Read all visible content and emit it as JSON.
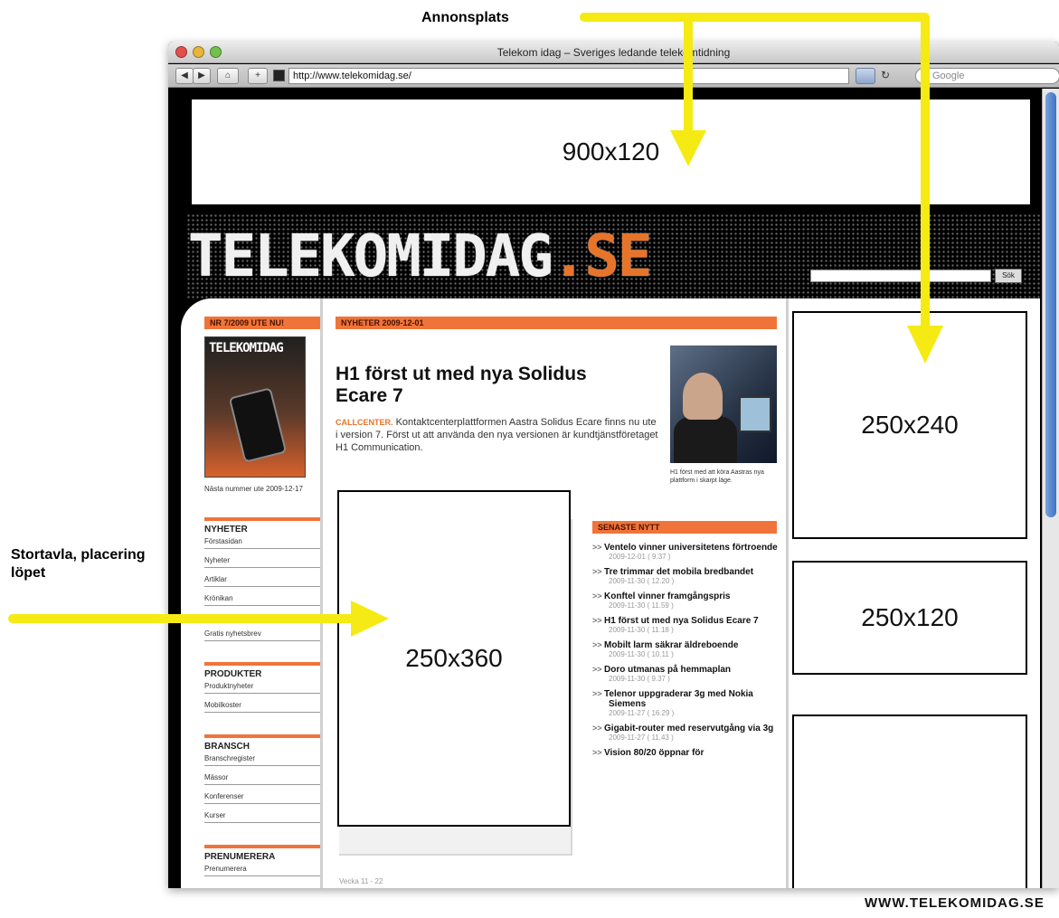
{
  "annotations": {
    "top_label": "Annonsplats",
    "left_label": "Stortavla, placering löpet",
    "footer_url": "WWW.TELEKOMIDAG.SE"
  },
  "browser": {
    "window_title": "Telekom idag – Sveriges ledande telekomtidning",
    "url": "http://www.telekomidag.se/",
    "search_placeholder": "Google"
  },
  "site": {
    "logo_main": "TELEKOMIDAG",
    "logo_suffix": ".SE",
    "search_button": "Sök"
  },
  "ads": {
    "top": "900x120",
    "right_1": "250x240",
    "right_2": "250x120",
    "mid": "250x360",
    "right_3": ""
  },
  "left_col": {
    "issue_bar": "NR 7/2009 UTE NU!",
    "mag_title": "TELEKOMIDAG",
    "caption": "Nästa nummer ute 2009-12-17",
    "sections": [
      {
        "title": "NYHETER",
        "items": [
          "Förstasidan",
          "Nyheter",
          "Artiklar",
          "Krönikan",
          "Gratis nyhetsbrev"
        ]
      },
      {
        "title": "PRODUKTER",
        "items": [
          "Produktnyheter",
          "Mobilkoster"
        ]
      },
      {
        "title": "BRANSCH",
        "items": [
          "Branschregister",
          "Mässor",
          "Konferenser",
          "Kurser"
        ]
      },
      {
        "title": "PRENUMERERA",
        "items": [
          "Prenumerera"
        ]
      }
    ]
  },
  "main": {
    "news_bar": "NYHETER 2009-12-01",
    "headline": "H1 först ut med nya Solidus Ecare 7",
    "kicker": "CALLCENTER.",
    "lead": "Kontaktcenterplattformen Aastra Solidus Ecare finns nu ute i version 7. Först ut att använda den nya versionen är kundtjänstföretaget H1 Communication.",
    "photo_caption": "H1 först med att köra Aastras nya plattform i skarpt läge.",
    "bottom_date": "Vecka 11 - 22",
    "latest_bar": "SENASTE NYTT",
    "latest": [
      {
        "title": "Ventelo vinner universitetens förtroende",
        "time": "2009-12-01 ( 9.37 )"
      },
      {
        "title": "Tre trimmar det mobila bredbandet",
        "time": "2009-11-30 ( 12.20 )"
      },
      {
        "title": "Konftel vinner framgångspris",
        "time": "2009-11-30 ( 11.59 )"
      },
      {
        "title": "H1 först ut med nya Solidus Ecare 7",
        "time": "2009-11-30 ( 11.18 )"
      },
      {
        "title": "Mobilt larm säkrar äldreboende",
        "time": "2009-11-30 ( 10.11 )"
      },
      {
        "title": "Doro utmanas på hemmaplan",
        "time": "2009-11-30 ( 9.37 )"
      },
      {
        "title": "Telenor uppgraderar 3g med Nokia Siemens",
        "time": "2009-11-27 ( 16.29 )"
      },
      {
        "title": "Gigabit-router med reservutgång via 3g",
        "time": "2009-11-27 ( 11.43 )"
      },
      {
        "title": "Vision 80/20 öppnar för",
        "time": ""
      }
    ]
  },
  "colors": {
    "accent_orange": "#f07439",
    "arrow_yellow": "#f5ea14"
  }
}
